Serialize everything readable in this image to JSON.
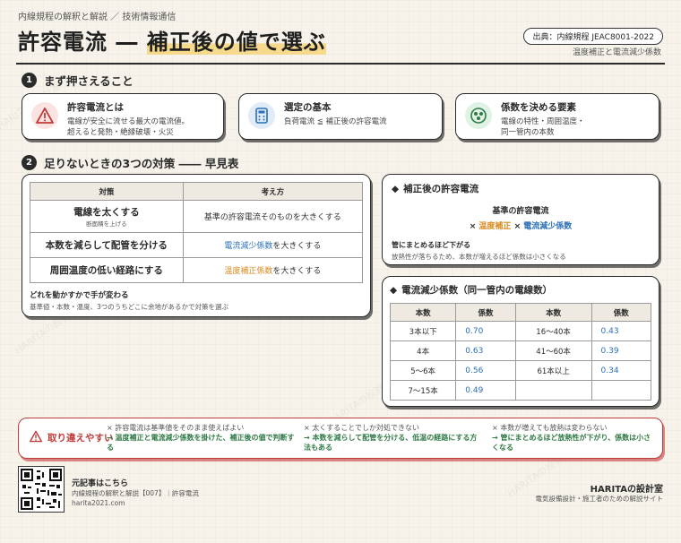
{
  "header": {
    "kicker": "内線規程の解釈と解説 ／ 技術情報通信",
    "title_prefix": "許容電流 ― ",
    "title_highlight": "補正後の値で選ぶ",
    "source": "出典：内線規程 JEAC8001-2022",
    "source_sub": "温度補正と電流減少係数"
  },
  "section1": {
    "number": "1",
    "title": "まず押さえること",
    "cards": [
      {
        "icon": "warning-icon",
        "title": "許容電流とは",
        "body1": "電線が安全に流せる最大の電流値。",
        "body2": "超えると発熱・絶縁破壊・火災"
      },
      {
        "icon": "calculator-icon",
        "title": "選定の基本",
        "body1": "負荷電流 ≦ 補正後の許容電流",
        "body2": ""
      },
      {
        "icon": "cable-icon",
        "title": "係数を決める要素",
        "body1": "電線の特性・周囲温度・",
        "body2": "同一管内の本数"
      }
    ]
  },
  "section2": {
    "number": "2",
    "title": "足りないときの3つの対策 ―― 早見表",
    "table": {
      "headers": [
        "対策",
        "考え方"
      ],
      "rows": [
        {
          "left": "電線を太くする",
          "left_note": "断面積を上げる",
          "right": "基準の許容電流そのものを大きくする",
          "right_hl": "",
          "right_tail": ""
        },
        {
          "left": "本数を減らして配管を分ける",
          "left_note": "",
          "right": "",
          "right_hl": "電流減少係数",
          "right_tail": "を大きくする"
        },
        {
          "left": "周囲温度の低い経路にする",
          "left_note": "",
          "right": "",
          "right_hl": "温度補正係数",
          "right_tail": "を大きくする"
        }
      ]
    },
    "note_title": "どれを動かすかで手が変わる",
    "note_body": "基準値・本数・温度、3つのうちどこに余地があるかで対策を選ぶ"
  },
  "corrected_panel": {
    "title": "補正後の許容電流",
    "formula_line1": "基準の許容電流",
    "formula_x1": "×",
    "formula_term1": "温度補正",
    "formula_x2": "×",
    "formula_term2": "電流減少係数",
    "note_title": "管にまとめるほど下がる",
    "note_body": "放熱性が落ちるため、本数が増えるほど係数は小さくなる"
  },
  "reduction_panel": {
    "title": "電流減少係数（同一管内の電線数）",
    "headers": [
      "本数",
      "係数",
      "本数",
      "係数"
    ],
    "rows": [
      [
        "3本以下",
        "0.70",
        "16〜40本",
        "0.43"
      ],
      [
        "4本",
        "0.63",
        "41〜60本",
        "0.39"
      ],
      [
        "5〜6本",
        "0.56",
        "61本以上",
        "0.34"
      ],
      [
        "7〜15本",
        "0.49",
        "",
        ""
      ]
    ]
  },
  "mistakes": {
    "label": "取り違えやすい",
    "items": [
      {
        "wrong": "× 許容電流は基準値をそのまま使えばよい",
        "right": "→ 温度補正と電流減少係数を掛けた、補正後の値で判断する"
      },
      {
        "wrong": "× 太くすることでしか対処できない",
        "right": "→ 本数を減らして配管を分ける、低温の経路にする方法もある"
      },
      {
        "wrong": "× 本数が増えても放熱は変わらない",
        "right": "→ 管にまとめるほど放熱性が下がり、係数は小さくなる"
      }
    ]
  },
  "footer": {
    "title": "元記事はこちら",
    "line1": "内線規程の解釈と解説【007】｜許容電流",
    "line2": "harita2021.com",
    "brand": "HARITAの設計室",
    "brand_sub": "電気設備設計・施工者のための解説サイト"
  },
  "watermark": "HARITAの設計室",
  "colors": {
    "accent_blue": "#2a6fb8",
    "accent_orange": "#d88a1e",
    "warn_red": "#c23b3b",
    "ok_green": "#2f7a45"
  }
}
